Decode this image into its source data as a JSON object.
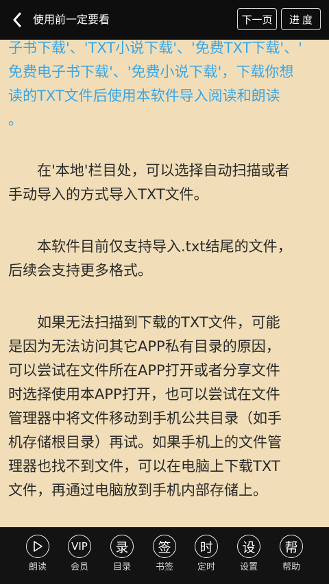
{
  "header": {
    "title": "使用前一定要看",
    "next_button": "下一页",
    "progress_button": "进度"
  },
  "article": {
    "link_lines": [
      "子书下载'、'TXT小说下载'、'免费TXT下载'、'",
      "免费电子书下载'、'免费小说下载'，下载你想",
      "读的TXT文件后使用本软件导入阅读和朗读",
      "。"
    ],
    "para1_lines": [
      "　　在'本地'栏目处，可以选择自动扫描或者",
      "手动导入的方式导入TXT文件。"
    ],
    "para2_lines": [
      "　　本软件目前仅支持导入.txt结尾的文件，",
      "后续会支持更多格式。"
    ],
    "para3_lines": [
      "　　如果无法扫描到下载的TXT文件，可能",
      "是因为无法访问其它APP私有目录的原因，",
      "可以尝试在文件所在APP打开或者分享文件",
      "时选择使用本APP打开，也可以尝试在文件",
      "管理器中将文件移动到手机公共目录（如手",
      "机存储根目录）再试。如果手机上的文件管",
      "理器也找不到文件，可以在电脑上下载TXT",
      "文件，再通过电脑放到手机内部存储上。"
    ]
  },
  "toolbar": {
    "items": [
      {
        "glyph": "▷",
        "label": "朗读",
        "icon": "play-icon"
      },
      {
        "glyph": "VIP",
        "label": "会员",
        "icon": "vip-icon"
      },
      {
        "glyph": "录",
        "label": "目录",
        "icon": "catalog-icon"
      },
      {
        "glyph": "签",
        "label": "书签",
        "icon": "bookmark-icon"
      },
      {
        "glyph": "时",
        "label": "定时",
        "icon": "timer-icon"
      },
      {
        "glyph": "设",
        "label": "设置",
        "icon": "settings-icon"
      },
      {
        "glyph": "帮",
        "label": "帮助",
        "icon": "help-icon"
      }
    ]
  },
  "colors": {
    "background": "#f1deb8",
    "link": "#3aa6e6",
    "text": "#2a2a2a",
    "bar": "#0e0e0e"
  }
}
